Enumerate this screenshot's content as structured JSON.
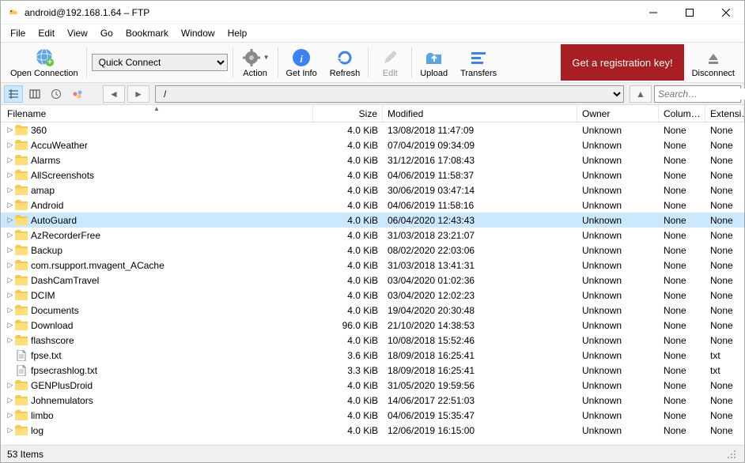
{
  "title": "android@192.168.1.64 – FTP",
  "menu": [
    "File",
    "Edit",
    "View",
    "Go",
    "Bookmark",
    "Window",
    "Help"
  ],
  "toolbar": {
    "open_connection": "Open Connection",
    "quick_connect": "Quick Connect",
    "action": "Action",
    "get_info": "Get Info",
    "refresh": "Refresh",
    "edit": "Edit",
    "upload": "Upload",
    "transfers": "Transfers",
    "reg_key": "Get a registration key!",
    "disconnect": "Disconnect"
  },
  "path": "/",
  "search_placeholder": "Search…",
  "columns": {
    "filename": "Filename",
    "size": "Size",
    "modified": "Modified",
    "owner": "Owner",
    "column": "Colum…",
    "extension": "Extensi…"
  },
  "selected_index": 6,
  "files": [
    {
      "type": "folder",
      "name": "360",
      "size": "4.0 KiB",
      "modified": "13/08/2018 11:47:09",
      "owner": "Unknown",
      "col": "None",
      "ext": "None"
    },
    {
      "type": "folder",
      "name": "AccuWeather",
      "size": "4.0 KiB",
      "modified": "07/04/2019 09:34:09",
      "owner": "Unknown",
      "col": "None",
      "ext": "None"
    },
    {
      "type": "folder",
      "name": "Alarms",
      "size": "4.0 KiB",
      "modified": "31/12/2016 17:08:43",
      "owner": "Unknown",
      "col": "None",
      "ext": "None"
    },
    {
      "type": "folder",
      "name": "AllScreenshots",
      "size": "4.0 KiB",
      "modified": "04/06/2019 11:58:37",
      "owner": "Unknown",
      "col": "None",
      "ext": "None"
    },
    {
      "type": "folder",
      "name": "amap",
      "size": "4.0 KiB",
      "modified": "30/06/2019 03:47:14",
      "owner": "Unknown",
      "col": "None",
      "ext": "None"
    },
    {
      "type": "folder",
      "name": "Android",
      "size": "4.0 KiB",
      "modified": "04/06/2019 11:58:16",
      "owner": "Unknown",
      "col": "None",
      "ext": "None"
    },
    {
      "type": "folder",
      "name": "AutoGuard",
      "size": "4.0 KiB",
      "modified": "06/04/2020 12:43:43",
      "owner": "Unknown",
      "col": "None",
      "ext": "None"
    },
    {
      "type": "folder",
      "name": "AzRecorderFree",
      "size": "4.0 KiB",
      "modified": "31/03/2018 23:21:07",
      "owner": "Unknown",
      "col": "None",
      "ext": "None"
    },
    {
      "type": "folder",
      "name": "Backup",
      "size": "4.0 KiB",
      "modified": "08/02/2020 22:03:06",
      "owner": "Unknown",
      "col": "None",
      "ext": "None"
    },
    {
      "type": "folder",
      "name": "com.rsupport.mvagent_ACache",
      "size": "4.0 KiB",
      "modified": "31/03/2018 13:41:31",
      "owner": "Unknown",
      "col": "None",
      "ext": "None"
    },
    {
      "type": "folder",
      "name": "DashCamTravel",
      "size": "4.0 KiB",
      "modified": "03/04/2020 01:02:36",
      "owner": "Unknown",
      "col": "None",
      "ext": "None"
    },
    {
      "type": "folder",
      "name": "DCIM",
      "size": "4.0 KiB",
      "modified": "03/04/2020 12:02:23",
      "owner": "Unknown",
      "col": "None",
      "ext": "None"
    },
    {
      "type": "folder",
      "name": "Documents",
      "size": "4.0 KiB",
      "modified": "19/04/2020 20:30:48",
      "owner": "Unknown",
      "col": "None",
      "ext": "None"
    },
    {
      "type": "folder",
      "name": "Download",
      "size": "96.0 KiB",
      "modified": "21/10/2020 14:38:53",
      "owner": "Unknown",
      "col": "None",
      "ext": "None"
    },
    {
      "type": "folder",
      "name": "flashscore",
      "size": "4.0 KiB",
      "modified": "10/08/2018 15:52:46",
      "owner": "Unknown",
      "col": "None",
      "ext": "None"
    },
    {
      "type": "file",
      "name": "fpse.txt",
      "size": "3.6 KiB",
      "modified": "18/09/2018 16:25:41",
      "owner": "Unknown",
      "col": "None",
      "ext": "txt"
    },
    {
      "type": "file",
      "name": "fpsecrashlog.txt",
      "size": "3.3 KiB",
      "modified": "18/09/2018 16:25:41",
      "owner": "Unknown",
      "col": "None",
      "ext": "txt"
    },
    {
      "type": "folder",
      "name": "GENPlusDroid",
      "size": "4.0 KiB",
      "modified": "31/05/2020 19:59:56",
      "owner": "Unknown",
      "col": "None",
      "ext": "None"
    },
    {
      "type": "folder",
      "name": "Johnemulators",
      "size": "4.0 KiB",
      "modified": "14/06/2017 22:51:03",
      "owner": "Unknown",
      "col": "None",
      "ext": "None"
    },
    {
      "type": "folder",
      "name": "limbo",
      "size": "4.0 KiB",
      "modified": "04/06/2019 15:35:47",
      "owner": "Unknown",
      "col": "None",
      "ext": "None"
    },
    {
      "type": "folder",
      "name": "log",
      "size": "4.0 KiB",
      "modified": "12/06/2019 16:15:00",
      "owner": "Unknown",
      "col": "None",
      "ext": "None"
    }
  ],
  "status": "53 Items"
}
